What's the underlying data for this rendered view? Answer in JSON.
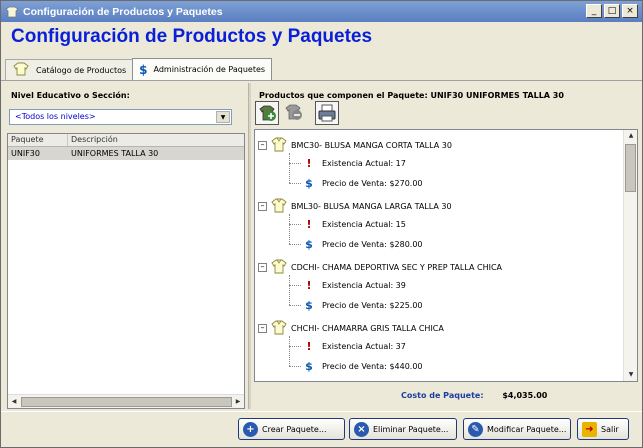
{
  "window": {
    "title": "Configuración de Productos y Paquetes",
    "controls": [
      "_",
      "□",
      "×"
    ]
  },
  "heading": "Configuración de Productos y Paquetes",
  "tabs": [
    {
      "label": "Catálogo de Productos",
      "icon": "shirt-icon",
      "active": false
    },
    {
      "label": "Administración de Paquetes",
      "icon": "dollar-icon",
      "active": true
    }
  ],
  "left": {
    "filter_label": "Nivel Educativo o Sección:",
    "filter_value": "<Todos los niveles>",
    "grid": {
      "columns": [
        "Paquete",
        "Descripción"
      ],
      "rows": [
        [
          "UNIF30",
          "UNIFORMES TALLA 30"
        ]
      ]
    }
  },
  "right": {
    "header": "Productos que componen el Paquete: UNIF30 UNIFORMES TALLA 30",
    "tree": [
      {
        "label": "BMC30- BLUSA MANGA CORTA TALLA 30",
        "stock": "Existencia Actual: 17",
        "price": "Precio de Venta: $270.00"
      },
      {
        "label": "BML30- BLUSA MANGA LARGA TALLA 30",
        "stock": "Existencia Actual: 15",
        "price": "Precio de Venta: $280.00"
      },
      {
        "label": "CDCHI- CHAMA DEPORTIVA SEC Y PREP TALLA CHICA",
        "stock": "Existencia Actual: 39",
        "price": "Precio de Venta: $225.00"
      },
      {
        "label": "CHCHI- CHAMARRA GRIS TALLA CHICA",
        "stock": "Existencia Actual: 37",
        "price": "Precio de Venta: $440.00"
      }
    ],
    "cost_label": "Costo de Paquete:",
    "cost_value": "$4,035.00"
  },
  "footer": {
    "create": "Crear Paquete...",
    "delete": "Eliminar Paquete...",
    "modify": "Modificar Paquete...",
    "exit": "Salir"
  },
  "colors": {
    "heading": "#0a1fd8",
    "titlebar": "#6a8ecb",
    "cost_label": "#1b3ea0"
  }
}
